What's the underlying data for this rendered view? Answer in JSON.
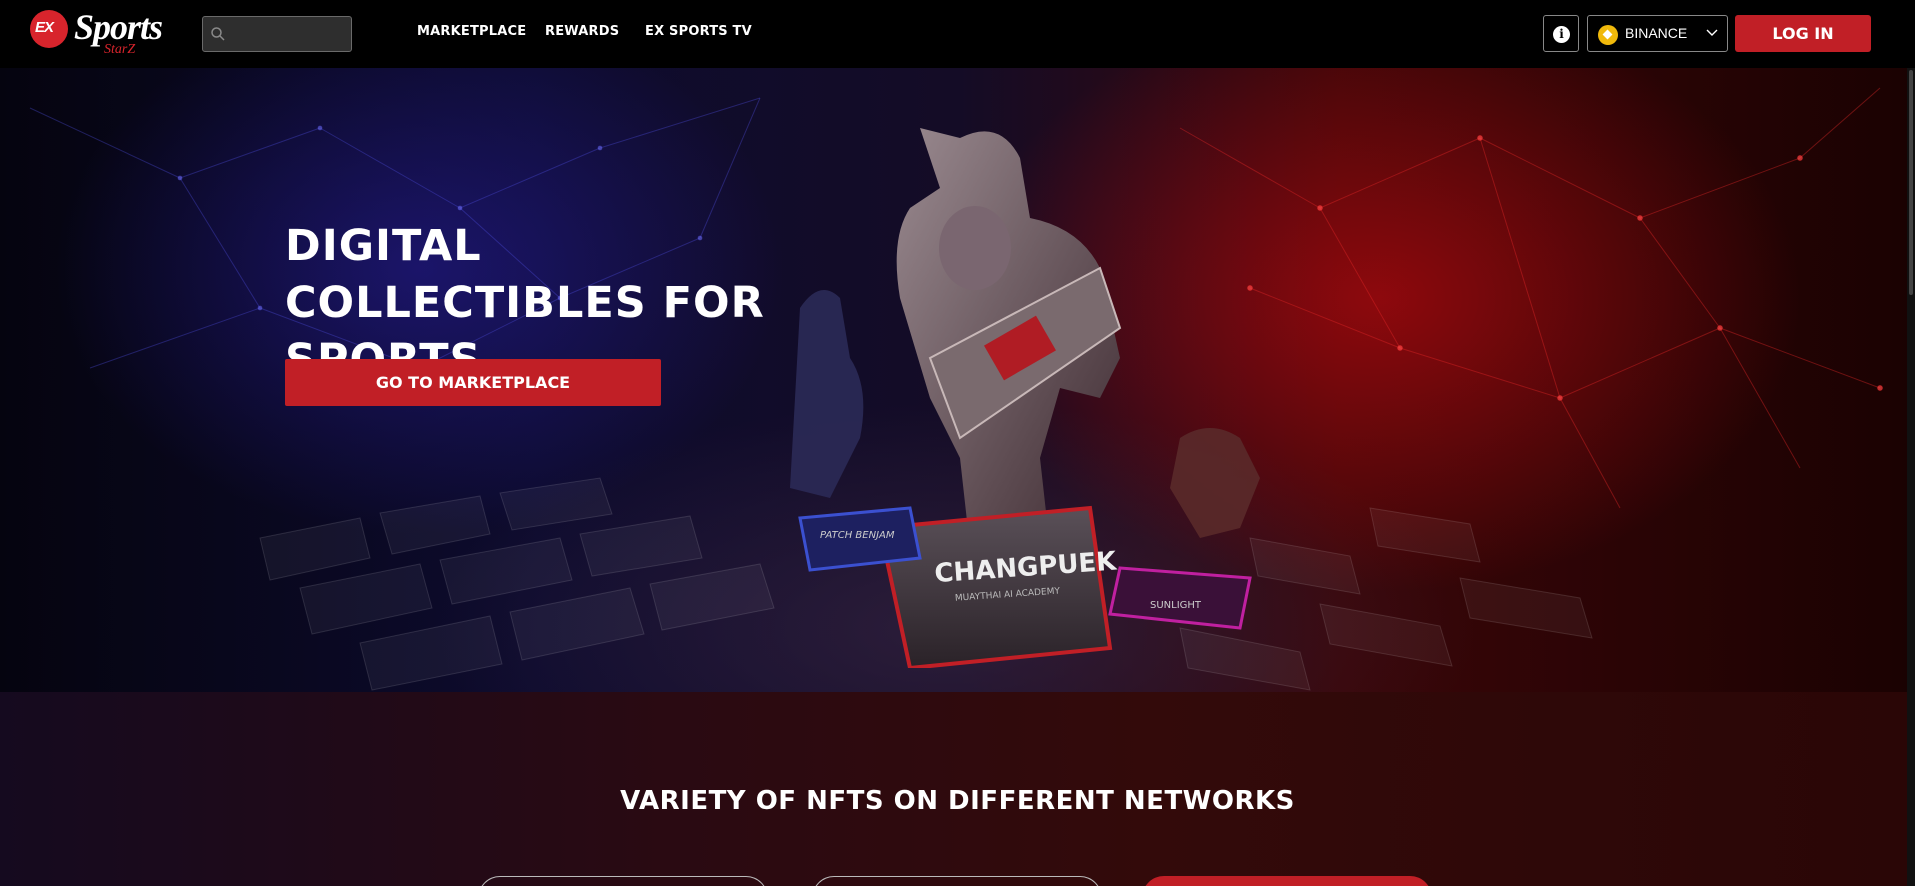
{
  "brand": {
    "logo_mark": "EX",
    "wordmark": "Sports",
    "sub": "StarZ"
  },
  "search": {
    "placeholder": "",
    "value": "",
    "icon": "search-icon"
  },
  "nav": {
    "items": [
      {
        "label": "MARKETPLACE"
      },
      {
        "label": "REWARDS"
      },
      {
        "label": "EX SPORTS TV"
      }
    ],
    "info_icon_glyph": "i",
    "network": {
      "label": "BINANCE",
      "icon": "binance-icon"
    },
    "login_label": "LOG IN"
  },
  "hero": {
    "title_line1": "DIGITAL COLLECTIBLES FOR",
    "title_line2": "SPORTS",
    "cta_label": "GO TO MARKETPLACE",
    "card_name": "CHANGPUEK",
    "card_sub": "MUAYTHAI AI ACADEMY",
    "left_card": "PATCH BENJAM",
    "right_card": "SUNLIGHT"
  },
  "section2": {
    "title": "VARIETY OF NFTS ON DIFFERENT NETWORKS"
  },
  "colors": {
    "accent": "#c11f26",
    "binance": "#f0b90b",
    "background": "#000000"
  }
}
